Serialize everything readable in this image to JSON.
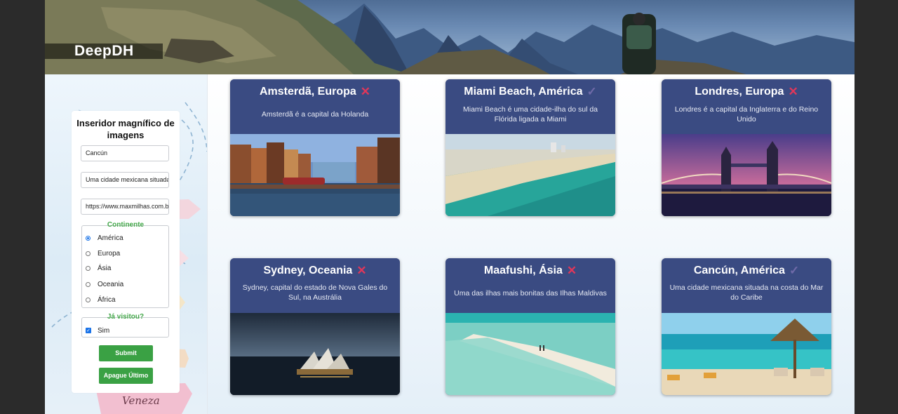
{
  "brand": {
    "name": "DeepDH"
  },
  "form": {
    "title": "Inseridor magnífico de imagens",
    "city_value": "Cancún",
    "description_value": "Uma cidade mexicana situada na costa do Mar do Caribe",
    "url_value": "https://www.maxmilhas.com.br",
    "continent_legend": "Continente",
    "continents": [
      {
        "label": "América",
        "selected": true
      },
      {
        "label": "Europa",
        "selected": false
      },
      {
        "label": "Ásia",
        "selected": false
      },
      {
        "label": "Oceania",
        "selected": false
      },
      {
        "label": "África",
        "selected": false
      }
    ],
    "visited_legend": "Já visitou?",
    "visited_label": "Sim",
    "visited_checked": true,
    "submit_label": "Submit",
    "delete_label": "Apague Último"
  },
  "cards": [
    {
      "title": "Amsterdã, Europa",
      "visited": false,
      "mark": "✕",
      "description": "Amsterdã é a capital da Holanda",
      "image": "amsterdam-canal"
    },
    {
      "title": "Miami Beach, América",
      "visited": true,
      "mark": "✓",
      "description": "Miami Beach é uma cidade-ilha do sul da Flórida ligada a Miami",
      "image": "miami-beach"
    },
    {
      "title": "Londres, Europa",
      "visited": false,
      "mark": "✕",
      "description": "Londres é a capital da Inglaterra e do Reino Unido",
      "image": "tower-bridge"
    },
    {
      "title": "Sydney, Oceania",
      "visited": false,
      "mark": "✕",
      "description": "Sydney, capital do estado de Nova Gales do Sul, na Austrália",
      "image": "sydney-opera-house"
    },
    {
      "title": "Maafushi, Ásia",
      "visited": false,
      "mark": "✕",
      "description": "Uma das ilhas mais bonitas das Ilhas Maldivas",
      "image": "maldives-sandbank"
    },
    {
      "title": "Cancún, América",
      "visited": true,
      "mark": "✓",
      "description": "Uma cidade mexicana situada na costa do Mar do Caribe",
      "image": "cancun-beach"
    }
  ],
  "colors": {
    "card_header": "#3a4b82",
    "not_visited_mark": "#e0375a",
    "visited_mark": "#6f6aa8",
    "button": "#3aa144",
    "legend": "#44a84a"
  }
}
